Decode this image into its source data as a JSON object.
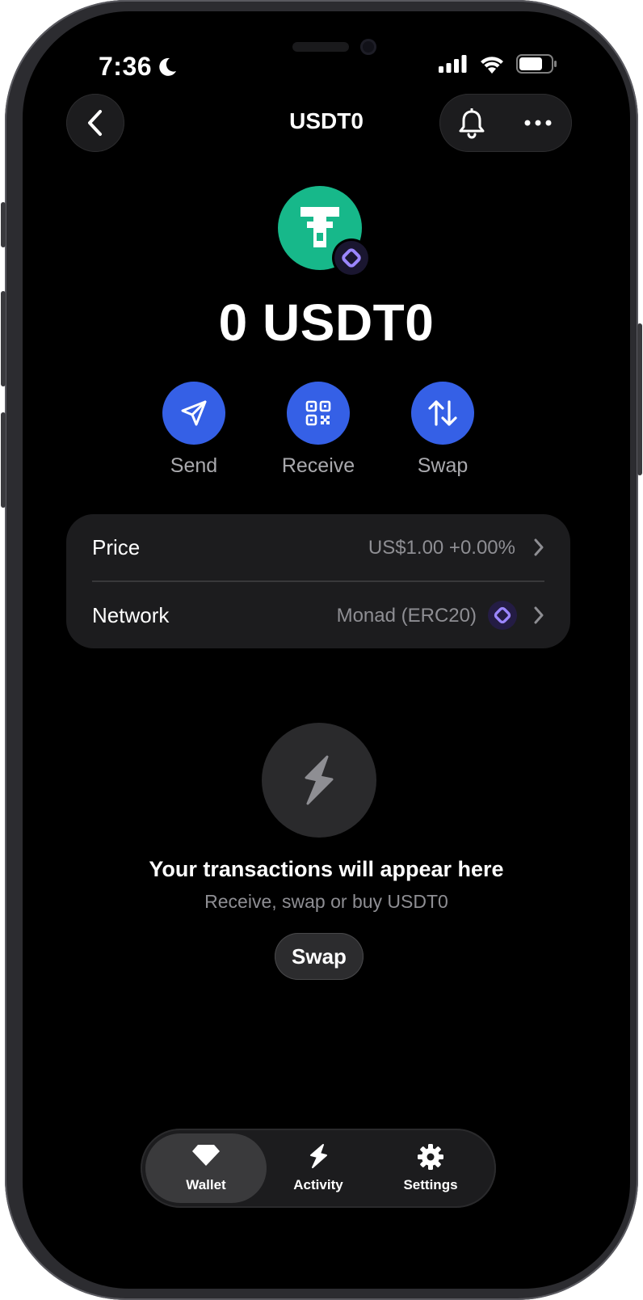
{
  "status_bar": {
    "time": "7:36",
    "icons": [
      "moon-icon",
      "cellular-signal-icon",
      "wifi-icon",
      "battery-icon"
    ]
  },
  "nav": {
    "title": "USDT0",
    "back_icon": "chevron-left-icon",
    "bell_icon": "bell-icon",
    "more_icon": "ellipsis-icon"
  },
  "token": {
    "logo_icon": "usdt0-token-icon",
    "chain_badge_icon": "monad-icon",
    "balance": "0 USDT0"
  },
  "actions": [
    {
      "label": "Send",
      "icon": "paper-plane-icon"
    },
    {
      "label": "Receive",
      "icon": "qr-code-icon"
    },
    {
      "label": "Swap",
      "icon": "swap-arrows-icon"
    }
  ],
  "info": {
    "price": {
      "label": "Price",
      "value": "US$1.00 +0.00%"
    },
    "network": {
      "label": "Network",
      "value": "Monad (ERC20)",
      "icon": "monad-icon"
    }
  },
  "empty_state": {
    "icon": "lightning-icon",
    "title": "Your transactions will appear here",
    "subtitle": "Receive, swap or buy USDT0",
    "button_label": "Swap"
  },
  "tabbar": {
    "tabs": [
      {
        "label": "Wallet",
        "icon": "diamond-icon",
        "active": true
      },
      {
        "label": "Activity",
        "icon": "lightning-icon",
        "active": false
      },
      {
        "label": "Settings",
        "icon": "gear-icon",
        "active": false
      }
    ]
  },
  "colors": {
    "background": "#000000",
    "card": "#1c1c1e",
    "accent_blue": "#3560e6",
    "token_green": "#17b88a",
    "monad_purple": "#836ef9",
    "secondary_text": "#8e8e93"
  }
}
